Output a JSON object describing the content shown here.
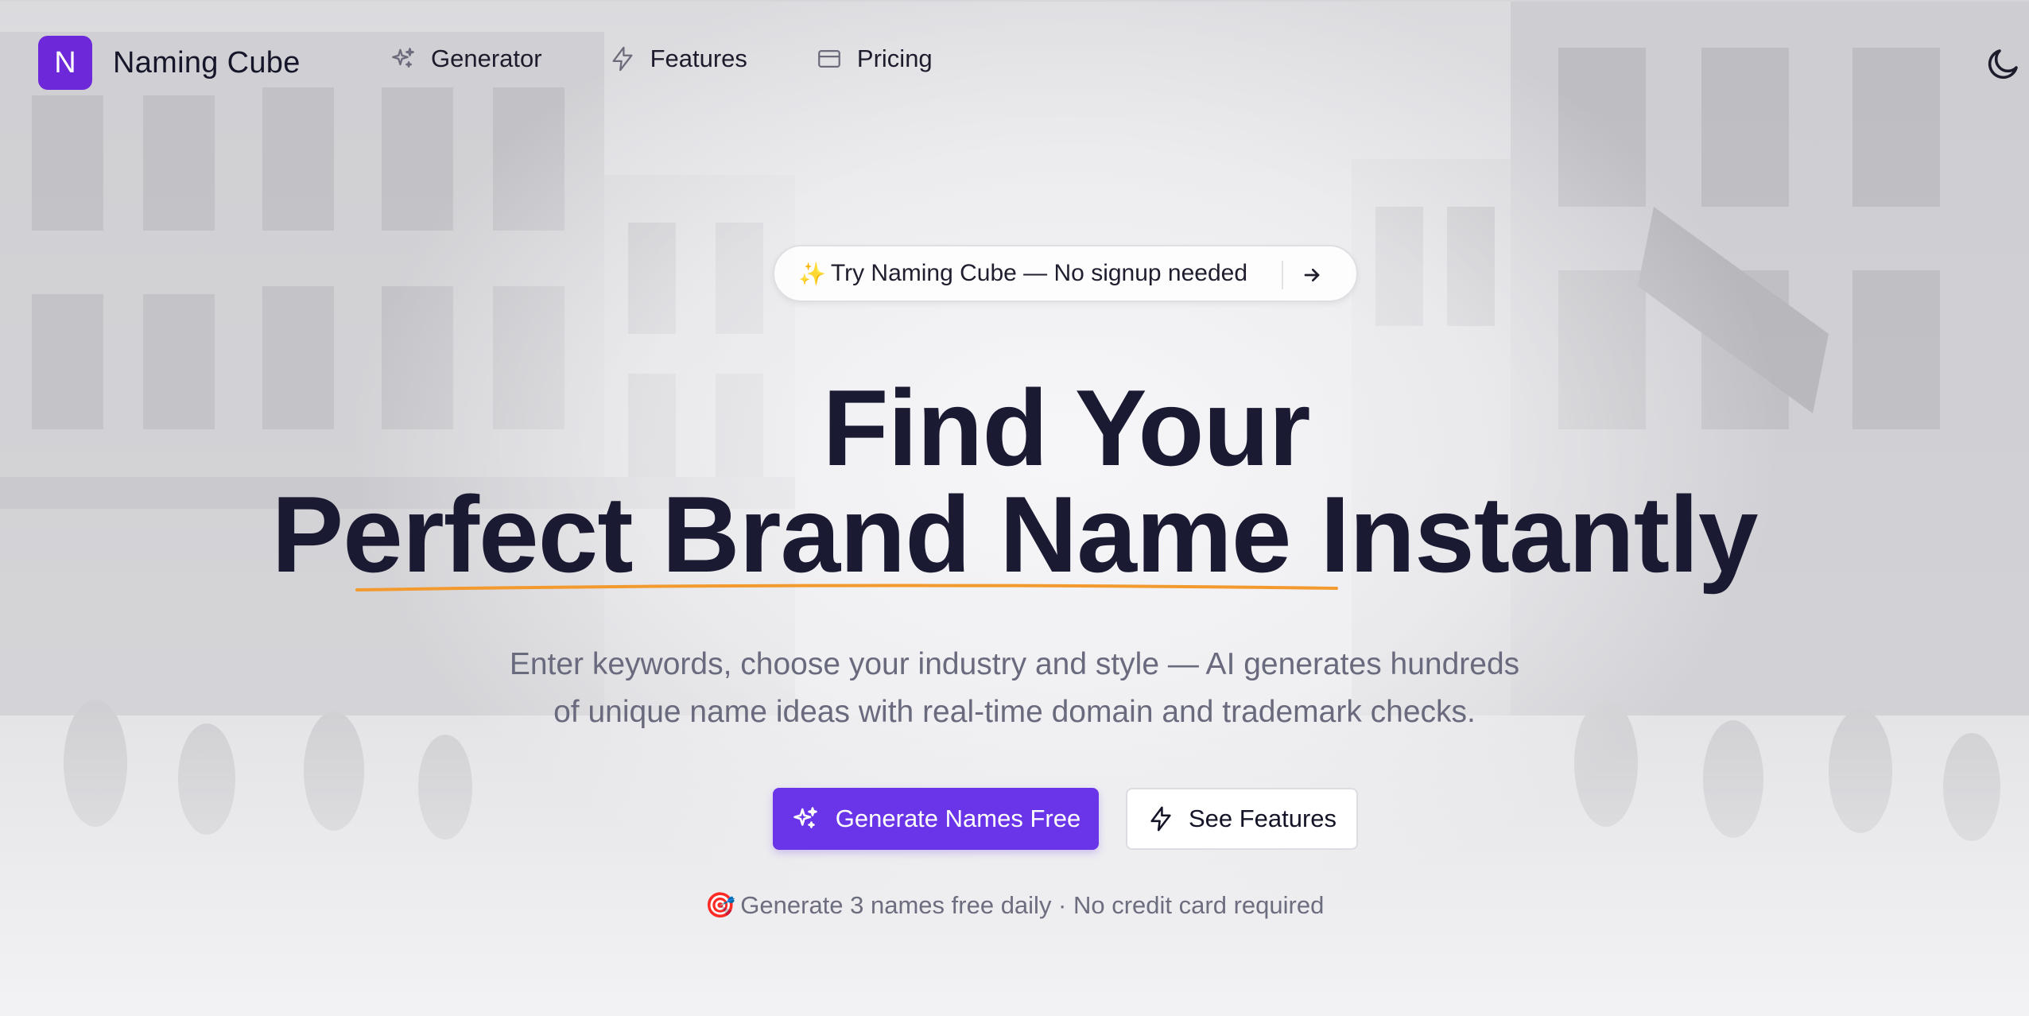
{
  "brand": {
    "logo_letter": "N",
    "name": "Naming Cube",
    "logo_color": "#6d28d9"
  },
  "nav": {
    "items": [
      {
        "label": "Generator",
        "icon": "sparkles-icon"
      },
      {
        "label": "Features",
        "icon": "lightning-icon"
      },
      {
        "label": "Pricing",
        "icon": "credit-card-icon"
      }
    ],
    "theme_toggle_icon": "moon-icon"
  },
  "announcement": {
    "icon": "✨",
    "text": "Try Naming Cube — No signup needed",
    "arrow_icon": "arrow-right-icon"
  },
  "hero": {
    "title_line1": "Find Your",
    "title_highlight": "Perfect Brand Name",
    "title_rest": " Instantly",
    "highlight_color": "#f29a2e",
    "subtitle_line1": "Enter keywords, choose your industry and style — AI generates hundreds",
    "subtitle_line2": "of unique name ideas with real-time domain and trademark checks."
  },
  "cta": {
    "primary_label": "Generate Names Free",
    "secondary_label": "See Features",
    "primary_color": "#6a35e8"
  },
  "note": {
    "icon": "🎯",
    "text": "Generate 3 names free daily · No credit card required"
  }
}
